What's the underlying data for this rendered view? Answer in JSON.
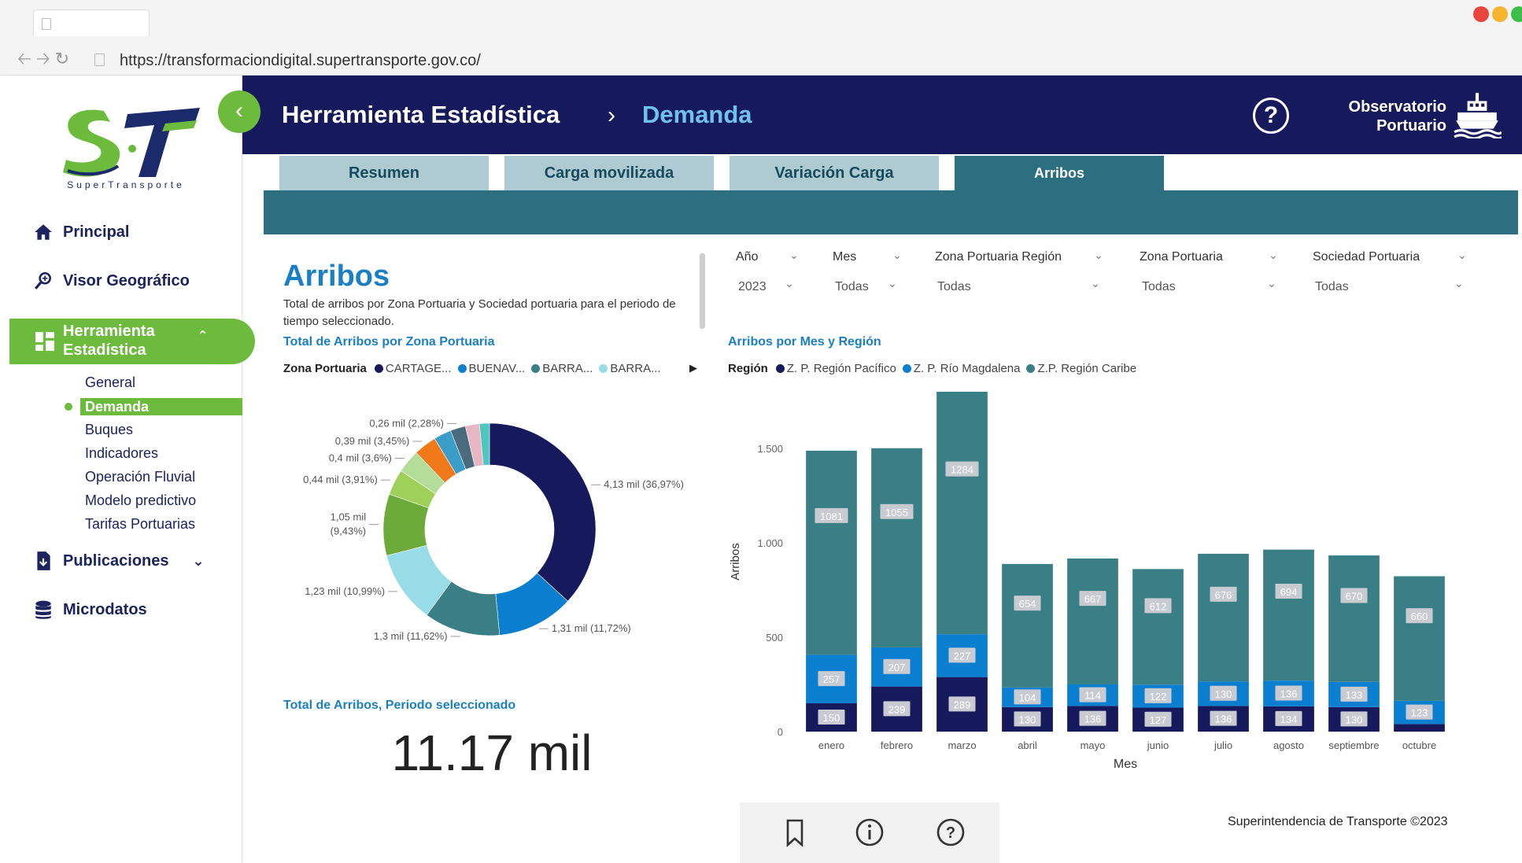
{
  "browser": {
    "url": "https://transformaciondigital.supertransporte.gov.co/"
  },
  "logo": {
    "subtitle": "SuperTransporte"
  },
  "sidebar": {
    "items": [
      {
        "label": "Principal",
        "icon": "home-icon"
      },
      {
        "label": "Visor Geográfico",
        "icon": "map-search-icon"
      },
      {
        "label": "Herramienta Estadística",
        "icon": "dashboard-grid-icon"
      },
      {
        "label": "Publicaciones",
        "icon": "document-download-icon"
      },
      {
        "label": "Microdatos",
        "icon": "database-icon"
      }
    ],
    "subitems": [
      "General",
      "Demanda",
      "Buques",
      "Indicadores",
      "Operación Fluvial",
      "Modelo predictivo",
      "Tarifas Portuarias"
    ],
    "active_subitem": "Demanda"
  },
  "header": {
    "crumb1": "Herramienta Estadística",
    "separator": "›",
    "crumb2": "Demanda",
    "brand": "Observatorio Portuario"
  },
  "tabs": [
    "Resumen",
    "Carga movilizada",
    "Variación Carga",
    "Arribos"
  ],
  "active_tab": "Arribos",
  "panel": {
    "title": "Arribos",
    "description": "Total de arribos por Zona Portuaria y Sociedad portuaria para el periodo de tiempo seleccionado.",
    "donut_title": "Total de Arribos por Zona Portuaria",
    "legend_label": "Zona Portuaria",
    "legend_items": [
      {
        "label": "CARTAGE...",
        "color": "#16195c"
      },
      {
        "label": "BUENAV...",
        "color": "#0a7fd0"
      },
      {
        "label": "BARRA...",
        "color": "#3a7f86"
      },
      {
        "label": "BARRA...",
        "color": "#98dce8"
      }
    ],
    "total_label": "Total de Arribos, Periodo seleccionado",
    "total_value": "11.17 mil"
  },
  "filters": [
    {
      "label": "Año",
      "value": "2023"
    },
    {
      "label": "Mes",
      "value": "Todas"
    },
    {
      "label": "Zona Portuaria Región",
      "value": "Todas"
    },
    {
      "label": "Zona Portuaria",
      "value": "Todas"
    },
    {
      "label": "Sociedad Portuaria",
      "value": "Todas"
    }
  ],
  "bar_section": {
    "title": "Arribos por Mes y Región",
    "legend_label": "Región",
    "legend_items": [
      {
        "label": "Z. P. Región Pacífico",
        "color": "#16195c"
      },
      {
        "label": "Z. P. Río Magdalena",
        "color": "#0a7fd0"
      },
      {
        "label": "Z.P. Región Caribe",
        "color": "#3a7f86"
      }
    ]
  },
  "chart_data": [
    {
      "type": "pie",
      "variant": "donut",
      "title": "Total de Arribos por Zona Portuaria",
      "slices": [
        {
          "label_text": "4,13 mil (36,97%)",
          "value": 4.13,
          "percent": 36.97,
          "color": "#16195c"
        },
        {
          "label_text": "1,31 mil (11,72%)",
          "value": 1.31,
          "percent": 11.72,
          "color": "#0a7fd0"
        },
        {
          "label_text": "1,3 mil (11,62%)",
          "value": 1.3,
          "percent": 11.62,
          "color": "#3a7f86"
        },
        {
          "label_text": "1,23 mil (10,99%)",
          "value": 1.23,
          "percent": 10.99,
          "color": "#98dce8"
        },
        {
          "label_text": "1,05 mil (9,43%)",
          "value": 1.05,
          "percent": 9.43,
          "color": "#6cab3a"
        },
        {
          "label_text": "0,44 mil (3,91%)",
          "value": 0.44,
          "percent": 3.91,
          "color": "#9ed05a"
        },
        {
          "label_text": "0,4 mil (3,6%)",
          "value": 0.4,
          "percent": 3.6,
          "color": "#b5dd9a"
        },
        {
          "label_text": "0,39 mil (3,45%)",
          "value": 0.39,
          "percent": 3.45,
          "color": "#f07a1a"
        },
        {
          "label_text": "",
          "value": 0.3,
          "percent": 2.7,
          "color": "#3a9ec8"
        },
        {
          "label_text": "0,26 mil (2,28%)",
          "value": 0.26,
          "percent": 2.28,
          "color": "#4a6a7e"
        },
        {
          "label_text": "",
          "value": 0.24,
          "percent": 2.15,
          "color": "#e8b7c3"
        },
        {
          "label_text": "",
          "value": 0.17,
          "percent": 1.55,
          "color": "#4ec6c0"
        }
      ]
    },
    {
      "type": "bar",
      "stacked": true,
      "title": "Arribos por Mes y Región",
      "xlabel": "Mes",
      "ylabel": "Arribos",
      "ylim": [
        0,
        1800
      ],
      "yticks": [
        0,
        500,
        1000,
        1500
      ],
      "ytick_labels": [
        "0",
        "500",
        "1.000",
        "1.500"
      ],
      "categories": [
        "enero",
        "febrero",
        "marzo",
        "abril",
        "mayo",
        "junio",
        "julio",
        "agosto",
        "septiembre",
        "octubre"
      ],
      "series": [
        {
          "name": "Z. P. Región Pacífico",
          "color": "#16195c",
          "values": [
            150,
            239,
            289,
            130,
            136,
            127,
            136,
            134,
            130,
            40
          ],
          "labels": [
            "150",
            "239",
            "289",
            "130",
            "136",
            "127",
            "136",
            "134",
            "130",
            ""
          ]
        },
        {
          "name": "Z. P. Río Magdalena",
          "color": "#0a7fd0",
          "values": [
            257,
            207,
            227,
            104,
            114,
            122,
            130,
            136,
            133,
            123
          ],
          "labels": [
            "257",
            "207",
            "227",
            "104",
            "114",
            "122",
            "130",
            "136",
            "133",
            "123"
          ]
        },
        {
          "name": "Z.P. Región Caribe",
          "color": "#3a7f86",
          "values": [
            1081,
            1055,
            1284,
            654,
            667,
            612,
            676,
            694,
            670,
            660
          ],
          "labels": [
            "1081",
            "1055",
            "1284",
            "654",
            "667",
            "612",
            "676",
            "694",
            "670",
            "660"
          ]
        }
      ]
    }
  ],
  "footer": {
    "copyright": "Superintendencia de Transporte ©2023"
  }
}
